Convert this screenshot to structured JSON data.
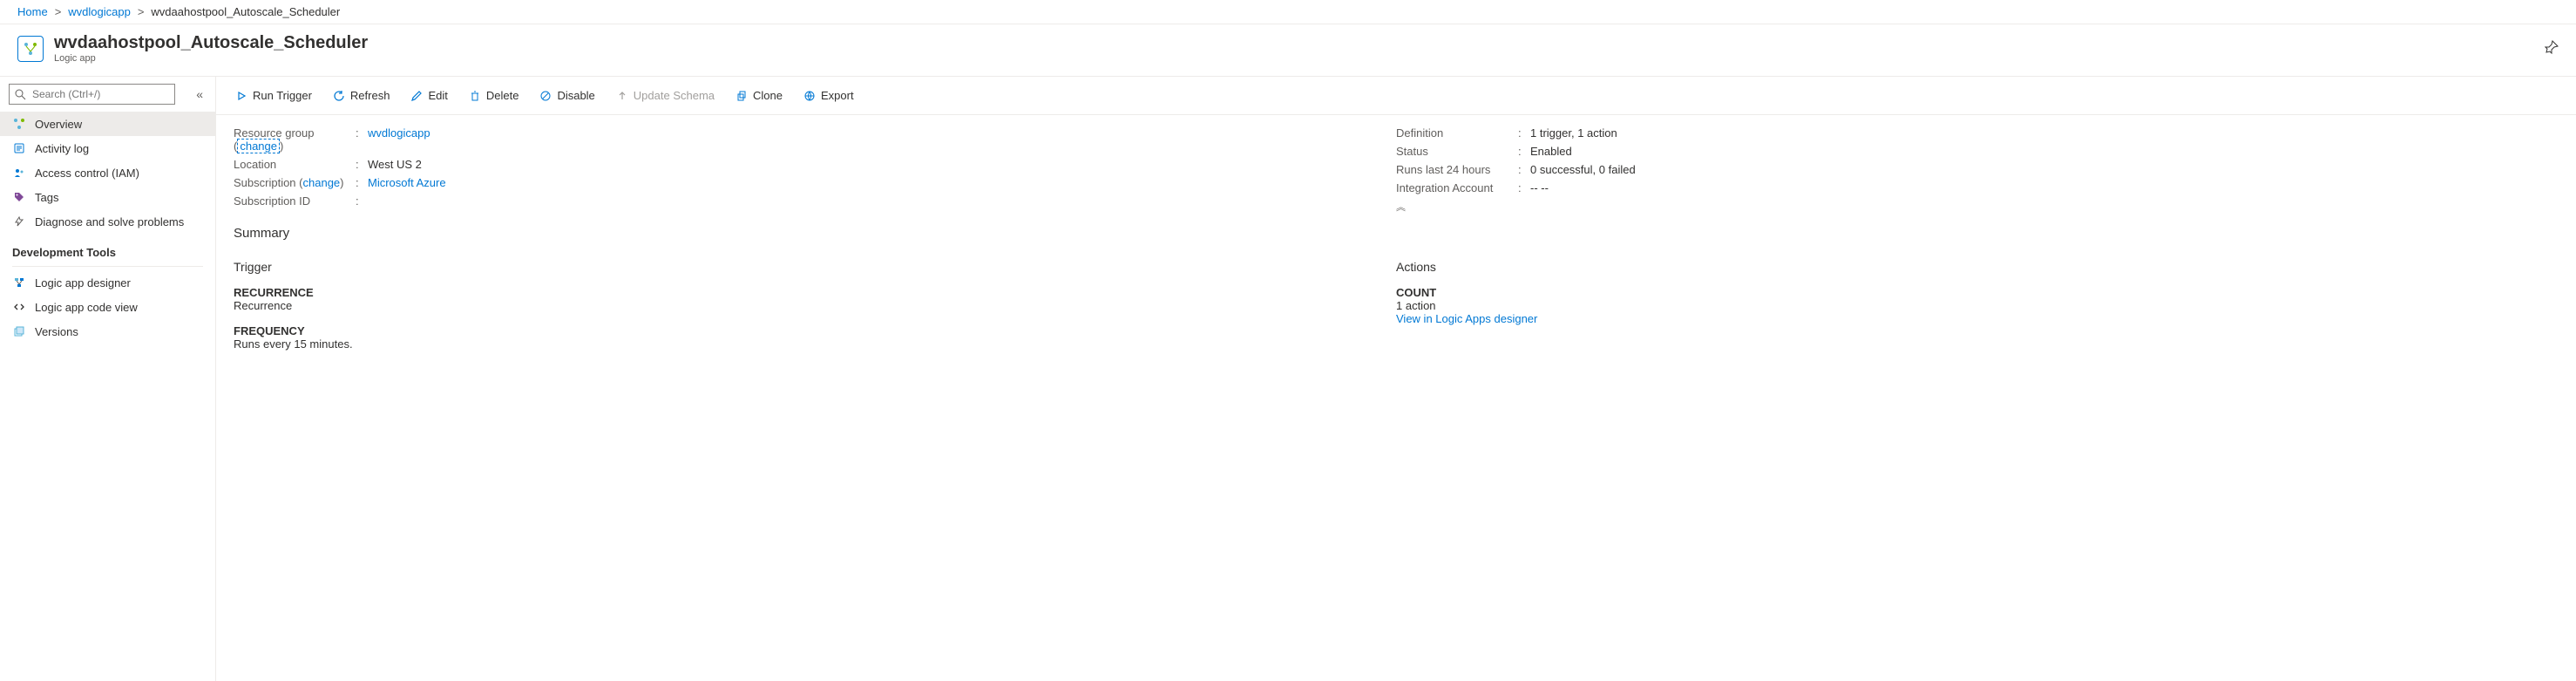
{
  "breadcrumbs": {
    "home": "Home",
    "parent": "wvdlogicapp",
    "current": "wvdaahostpool_Autoscale_Scheduler"
  },
  "header": {
    "title": "wvdaahostpool_Autoscale_Scheduler",
    "subtitle": "Logic app"
  },
  "search": {
    "placeholder": "Search (Ctrl+/)"
  },
  "sidebar": {
    "items": [
      {
        "label": "Overview"
      },
      {
        "label": "Activity log"
      },
      {
        "label": "Access control (IAM)"
      },
      {
        "label": "Tags"
      },
      {
        "label": "Diagnose and solve problems"
      }
    ],
    "section_title": "Development Tools",
    "dev_items": [
      {
        "label": "Logic app designer"
      },
      {
        "label": "Logic app code view"
      },
      {
        "label": "Versions"
      }
    ]
  },
  "toolbar": {
    "run": "Run Trigger",
    "refresh": "Refresh",
    "edit": "Edit",
    "delete": "Delete",
    "disable": "Disable",
    "update_schema": "Update Schema",
    "clone": "Clone",
    "export": "Export"
  },
  "essentials": {
    "left": {
      "resource_group_label": "Resource group",
      "resource_group_change": "change",
      "resource_group_value": "wvdlogicapp",
      "location_label": "Location",
      "location_value": "West US 2",
      "subscription_label": "Subscription",
      "subscription_change": "change",
      "subscription_value": "Microsoft Azure",
      "subscription_id_label": "Subscription ID",
      "subscription_id_value": ""
    },
    "right": {
      "definition_label": "Definition",
      "definition_value": "1 trigger, 1 action",
      "status_label": "Status",
      "status_value": "Enabled",
      "runs_label": "Runs last 24 hours",
      "runs_value": "0 successful, 0 failed",
      "integration_label": "Integration Account",
      "integration_value": "-- --"
    }
  },
  "summary": {
    "title": "Summary",
    "trigger": {
      "heading": "Trigger",
      "recurrence_label": "RECURRENCE",
      "recurrence_value": "Recurrence",
      "frequency_label": "FREQUENCY",
      "frequency_value": "Runs every 15 minutes."
    },
    "actions": {
      "heading": "Actions",
      "count_label": "COUNT",
      "count_value": "1 action",
      "view_link": "View in Logic Apps designer"
    }
  }
}
